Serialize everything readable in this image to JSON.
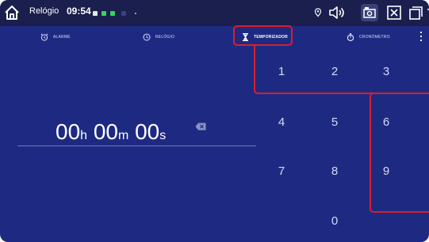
{
  "statusbar": {
    "app_title": "Relógio",
    "time": "09:54"
  },
  "tabs": [
    {
      "label": "ALARME"
    },
    {
      "label": "RELÓGIO"
    },
    {
      "label": "TEMPORIZADOR"
    },
    {
      "label": "CRONÓMETRO"
    }
  ],
  "timer": {
    "hours": "00",
    "hours_unit": "h",
    "minutes": "00",
    "minutes_unit": "m",
    "seconds": "00",
    "seconds_unit": "s"
  },
  "keypad": {
    "k1": "1",
    "k2": "2",
    "k3": "3",
    "k4": "4",
    "k5": "5",
    "k6": "6",
    "k7": "7",
    "k8": "8",
    "k9": "9",
    "k0": "0"
  },
  "colors": {
    "background": "#1e2a82",
    "statusbar": "#1a1f4d",
    "highlight": "#d81f2a"
  }
}
